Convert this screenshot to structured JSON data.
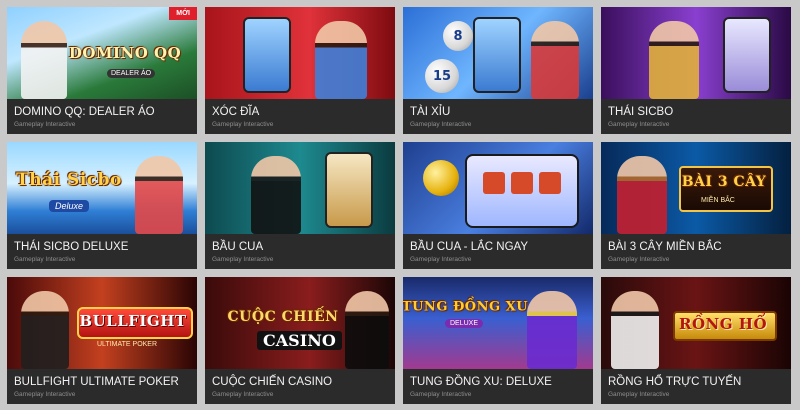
{
  "games": [
    {
      "title": "DOMINO QQ: DEALER ÁO",
      "provider": "Gameplay Interactive",
      "badge": "MỚI",
      "logo": "DOMINO QQ",
      "logo_sub": "DEALER ÁO"
    },
    {
      "title": "XÓC ĐĨA",
      "provider": "Gameplay Interactive"
    },
    {
      "title": "TÀI XỈU",
      "provider": "Gameplay Interactive"
    },
    {
      "title": "THÁI SICBO",
      "provider": "Gameplay Interactive"
    },
    {
      "title": "THÁI SICBO DELUXE",
      "provider": "Gameplay Interactive",
      "logo": "Thái Sicbo",
      "logo_sub": "Deluxe"
    },
    {
      "title": "BẦU CUA",
      "provider": "Gameplay Interactive"
    },
    {
      "title": "BẦU CUA - LẮC NGAY",
      "provider": "Gameplay Interactive"
    },
    {
      "title": "BÀI 3 CÂY MIỀN BẮC",
      "provider": "Gameplay Interactive",
      "logo": "BÀI 3 CÂY",
      "logo_sub": "MIỀN BẮC"
    },
    {
      "title": "BULLFIGHT ULTIMATE POKER",
      "provider": "Gameplay Interactive",
      "logo": "BULLFIGHT",
      "logo_sub": "ULTIMATE POKER"
    },
    {
      "title": "CUỘC CHIẾN CASINO",
      "provider": "Gameplay Interactive",
      "logo": "CUỘC CHIẾN",
      "logo_sub": "CASINO"
    },
    {
      "title": "TUNG ĐỒNG XU: DELUXE",
      "provider": "Gameplay Interactive",
      "logo": "TUNG ĐỒNG XU",
      "logo_sub": "DELUXE"
    },
    {
      "title": "RỒNG HỔ TRỰC TUYẾN",
      "provider": "Gameplay Interactive",
      "logo": "RỒNG HỔ"
    }
  ],
  "ball_numbers": [
    "8",
    "15"
  ],
  "colors": {
    "page_bg": "#c9c9c9",
    "card_bg": "#2b2b2b",
    "badge": "#e01f2d",
    "logo": "#ffd24a"
  }
}
